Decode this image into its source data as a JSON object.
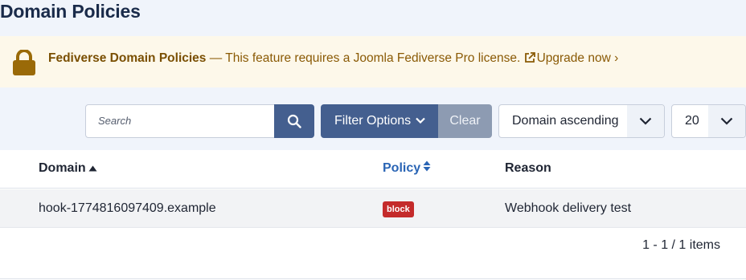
{
  "page": {
    "title": "Domain Policies"
  },
  "notice": {
    "feature": "Fediverse Domain Policies",
    "message": " — This feature requires a Joomla Fediverse Pro license. ",
    "upgrade_label": "Upgrade now ›",
    "icon": "lock-icon",
    "color": "#8a5a05"
  },
  "toolbar": {
    "search_placeholder": "Search",
    "filter_label": "Filter Options",
    "clear_label": "Clear",
    "sort_value": "Domain ascending",
    "limit_value": "20"
  },
  "table": {
    "columns": {
      "domain": "Domain",
      "policy": "Policy",
      "reason": "Reason"
    },
    "rows": [
      {
        "domain": "hook-1774816097409.example",
        "policy": "block",
        "reason": "Webhook delivery test"
      }
    ]
  },
  "pagination": {
    "summary": "1 - 1 / 1 items"
  },
  "colors": {
    "primary": "#445f8f",
    "clear": "#8d9bb2",
    "badge_block": "#c42b2b",
    "link": "#2a65b5"
  }
}
